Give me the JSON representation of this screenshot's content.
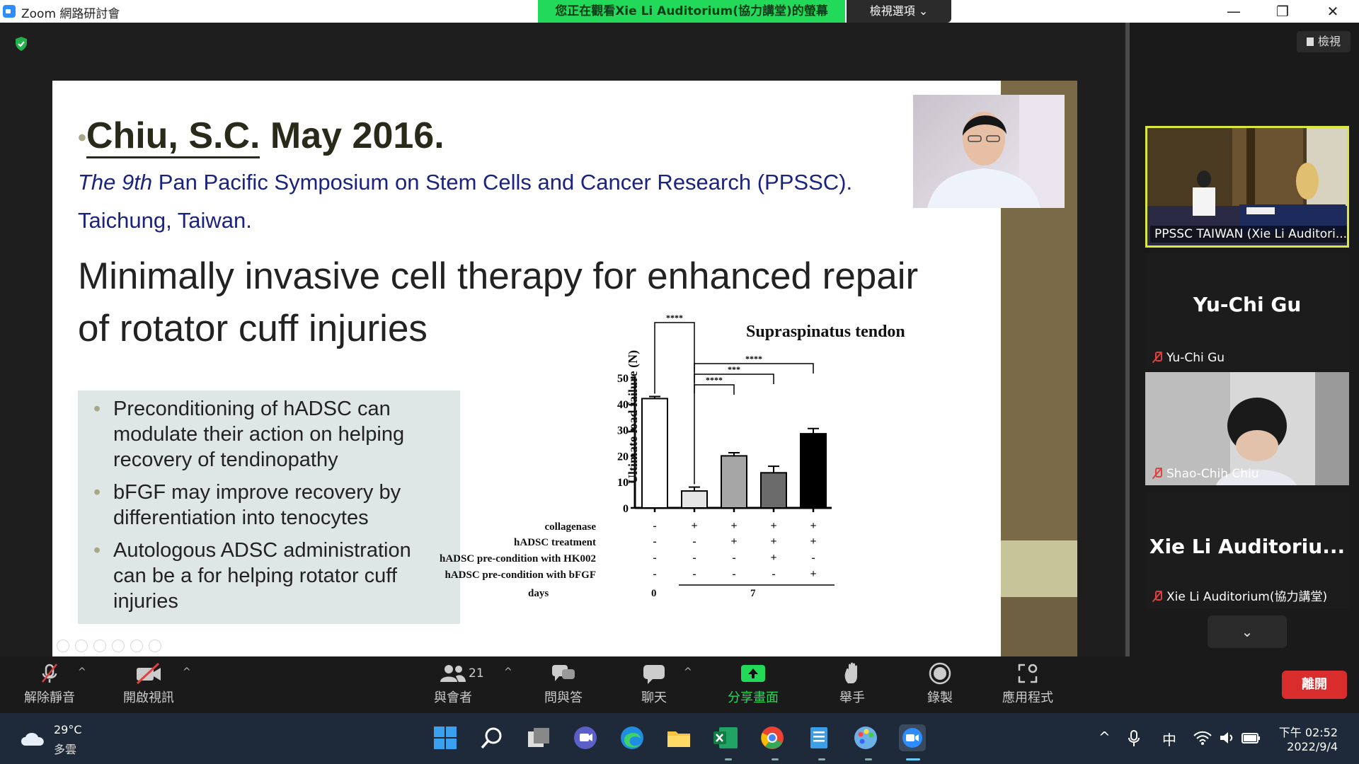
{
  "window": {
    "title": "Zoom 網路研討會",
    "viewing_banner": "您正在觀看Xie Li Auditorium(協力講堂)的螢幕",
    "view_options": "檢視選項 ⌄",
    "minimize": "—",
    "restore": "❐",
    "close": "✕"
  },
  "right_panel": {
    "view_button": "檢視",
    "participants": [
      {
        "name": "PPSSC TAIWAN (Xie Li Auditori...",
        "big": "",
        "muted": false
      },
      {
        "name": "Yu-Chi Gu",
        "big": "Yu-Chi Gu",
        "muted": true
      },
      {
        "name": "Shao-Chih Chiu",
        "big": "",
        "muted": true
      },
      {
        "name": "Xie Li Auditorium(協力講堂)",
        "big": "Xie Li Auditoriu...",
        "muted": true
      }
    ],
    "scroll_down": "⌄"
  },
  "slide": {
    "head_bullet": "•",
    "head_name": "Chiu, S.C.",
    "head_date": " May 2016.",
    "sub_italic": "The 9th",
    "sub_rest": " Pan Pacific Symposium on Stem Cells and Cancer Research (PPSSC).",
    "sub2": "Taichung, Taiwan.",
    "title_line1": "Minimally invasive cell therapy for enhanced repair",
    "title_line2": "of rotator cuff injuries",
    "bullets": [
      "Preconditioning of hADSC can modulate their action on helping recovery of tendinopathy",
      "bFGF may improve recovery by differentiation into tenocytes",
      "Autologous ADSC administration can be a for helping rotator cuff injuries"
    ]
  },
  "chart_data": {
    "type": "bar",
    "title": "Supraspinatus tendon",
    "ylabel": "Ultimate load failure (N)",
    "ylim": [
      0,
      50
    ],
    "yticks": [
      "0",
      "10",
      "20",
      "30",
      "40",
      "50"
    ],
    "values": [
      42,
      6.5,
      20,
      13.5,
      28.5
    ],
    "errors": [
      0.8,
      1.5,
      1.2,
      2.5,
      2.0
    ],
    "bar_colors": [
      "#ffffff",
      "#e6e6e6",
      "#a6a6a6",
      "#6b6b6b",
      "#000000"
    ],
    "significance": [
      {
        "from": 0,
        "to": 1,
        "label": "****"
      },
      {
        "from": 1,
        "to": 2,
        "label": "****"
      },
      {
        "from": 1,
        "to": 3,
        "label": "***"
      },
      {
        "from": 1,
        "to": 4,
        "label": "****"
      }
    ],
    "conditions": [
      {
        "label": "collagenase",
        "values": [
          "-",
          "+",
          "+",
          "+",
          "+"
        ]
      },
      {
        "label": "hADSC treatment",
        "values": [
          "-",
          "-",
          "+",
          "+",
          "+"
        ]
      },
      {
        "label": "hADSC pre-condition with HK002",
        "values": [
          "-",
          "-",
          "-",
          "+",
          "-"
        ]
      },
      {
        "label": "hADSC pre-condition with bFGF",
        "values": [
          "-",
          "-",
          "-",
          "-",
          "+"
        ]
      }
    ],
    "days_label": "days",
    "days": [
      "0",
      "7"
    ]
  },
  "toolbar": {
    "unmute": "解除靜音",
    "start_video": "開啟視訊",
    "participants": "與會者",
    "participant_count": "21",
    "qa": "問與答",
    "chat": "聊天",
    "share": "分享畫面",
    "raise_hand": "舉手",
    "record": "錄製",
    "apps": "應用程式",
    "leave": "離開",
    "caret": "^"
  },
  "taskbar": {
    "temp": "29°C",
    "weather": "多雲",
    "ime": "中",
    "time": "下午 02:52",
    "date": "2022/9/4"
  },
  "colors": {
    "banner_green": "#23d959",
    "leave_red": "#d92c2c",
    "active_tile_border": "#d9e83a",
    "share_green": "#23d959"
  }
}
